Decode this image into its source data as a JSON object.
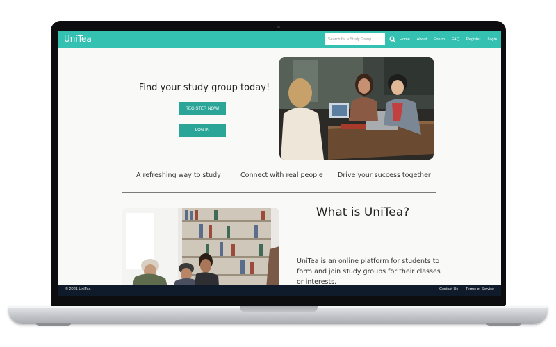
{
  "navbar": {
    "brand": "UniTea",
    "search": {
      "placeholder": "Search for a Study Group",
      "value": ""
    },
    "links": [
      "Home",
      "About",
      "Forum",
      "FAQ",
      "Register",
      "Login"
    ]
  },
  "hero": {
    "title": "Find your study group today!",
    "register_label": "REGISTER NOW!",
    "login_label": "LOG IN"
  },
  "features": [
    "A refreshing way to study",
    "Connect with real people",
    "Drive your success together"
  ],
  "about": {
    "title": "What is UniTea?",
    "text": "UniTea is an online platform for students to form and join study groups for their classes or interests."
  },
  "footer": {
    "copyright": "© 2021 UniTea",
    "links": [
      "Contact Us",
      "Terms of Service"
    ]
  },
  "colors": {
    "nav_bg": "#35c1b2",
    "button_bg": "#2aa597",
    "footer_bg": "#0f1b2b",
    "page_bg": "#f9f9f7"
  },
  "icons": {
    "search": "search-icon"
  }
}
